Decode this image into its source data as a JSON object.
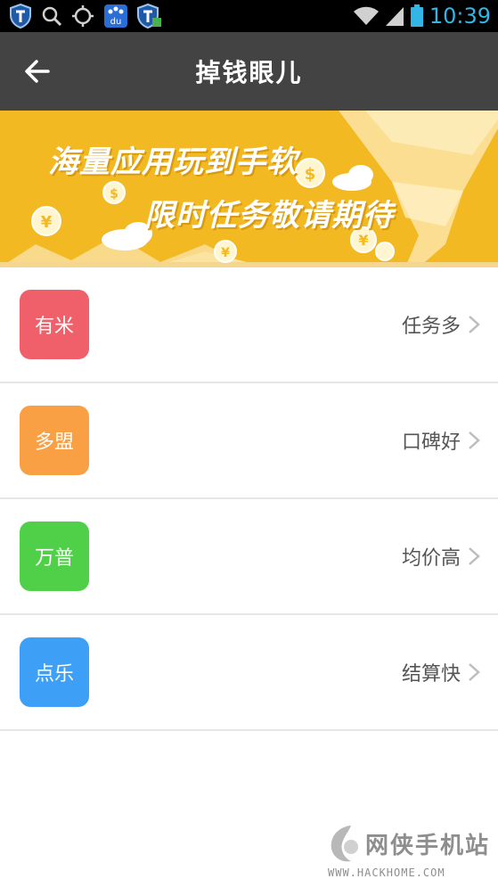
{
  "status_bar": {
    "time": "10:39",
    "left_icons": [
      "shield-app-icon",
      "search-icon",
      "locate-icon",
      "baidu-icon",
      "shield-app-icon-2"
    ],
    "right_icons": [
      "wifi-icon",
      "signal-icon",
      "battery-icon"
    ],
    "baidu_text": "du"
  },
  "header": {
    "title": "掉钱眼儿",
    "back_icon": "back-arrow-icon"
  },
  "banner": {
    "line1": "海量应用玩到手软",
    "line2": "限时任务敬请期待",
    "background": "#f3b923"
  },
  "list": [
    {
      "badge": "有米",
      "label": "任务多",
      "color": "#f0606a"
    },
    {
      "badge": "多盟",
      "label": "口碑好",
      "color": "#f9a045"
    },
    {
      "badge": "万普",
      "label": "均价高",
      "color": "#4fd048"
    },
    {
      "badge": "点乐",
      "label": "结算快",
      "color": "#3d9ff5"
    }
  ],
  "watermark": {
    "name": "网侠手机站",
    "url": "WWW.HACKHOME.COM"
  }
}
